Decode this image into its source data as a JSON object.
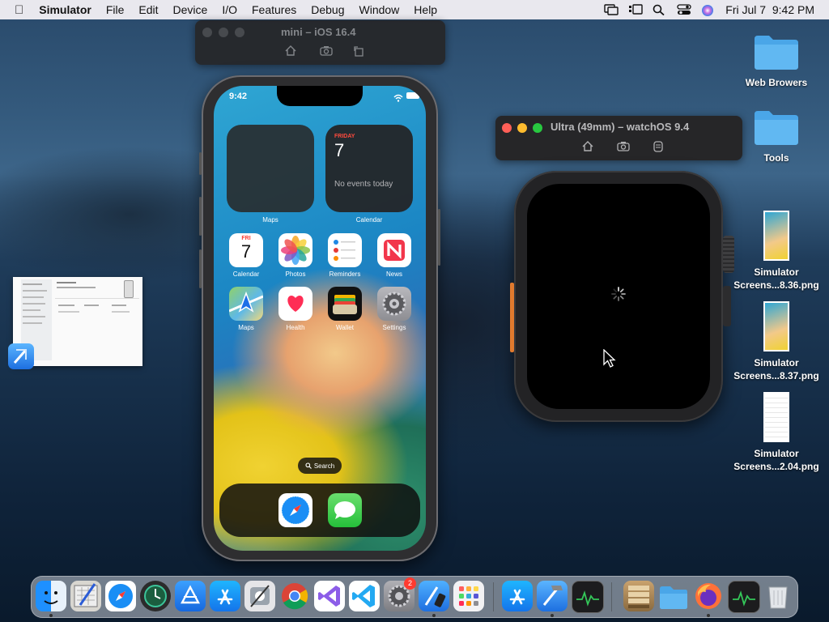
{
  "menubar": {
    "apple": "",
    "app_name": "Simulator",
    "menus": [
      "File",
      "Edit",
      "Device",
      "I/O",
      "Features",
      "Debug",
      "Window",
      "Help"
    ],
    "clock": "Fri Jul 7  9:42 PM"
  },
  "iphone_window": {
    "title": "mini – iOS 16.4",
    "tools": [
      "home-icon",
      "screenshot-icon",
      "rotate-icon"
    ]
  },
  "watch_window": {
    "title": "Ultra (49mm) – watchOS 9.4",
    "tools": [
      "home-icon",
      "screenshot-icon",
      "side-button-icon"
    ]
  },
  "iphone": {
    "status_time": "9:42",
    "widgets": {
      "maps_label": "Maps",
      "calendar_label": "Calendar",
      "calendar_day": "FRIDAY",
      "calendar_date": "7",
      "calendar_events": "No events today"
    },
    "apps": [
      {
        "label": "Calendar",
        "icon": "calendar-icon",
        "top": "FRI",
        "num": "7"
      },
      {
        "label": "Photos",
        "icon": "photos-icon"
      },
      {
        "label": "Reminders",
        "icon": "reminders-icon"
      },
      {
        "label": "News",
        "icon": "news-icon"
      },
      {
        "label": "Maps",
        "icon": "maps-icon"
      },
      {
        "label": "Health",
        "icon": "health-icon"
      },
      {
        "label": "Wallet",
        "icon": "wallet-icon"
      },
      {
        "label": "Settings",
        "icon": "settings-icon"
      }
    ],
    "search_pill": "Search",
    "dock": [
      "safari-icon",
      "messages-icon"
    ]
  },
  "desktop_files": [
    {
      "name": "Web Browers",
      "type": "folder"
    },
    {
      "name": "Tools",
      "type": "folder"
    },
    {
      "name": "Simulator Screens...8.36.png",
      "line1": "Simulator",
      "line2": "Screens...8.36.png",
      "type": "image"
    },
    {
      "name": "Simulator Screens...8.37.png",
      "line1": "Simulator",
      "line2": "Screens...8.37.png",
      "type": "image"
    },
    {
      "name": "Simulator Screens...2.04.png",
      "line1": "Simulator",
      "line2": "Screens...2.04.png",
      "type": "image"
    }
  ],
  "dock": {
    "badge": "2",
    "apps": [
      "finder-icon",
      "sketchpad-icon",
      "safari-icon",
      "time-machine-icon",
      "app-store-connect-icon",
      "app-store-icon",
      "system-tools-icon",
      "chrome-icon",
      "visual-studio-icon",
      "vscode-icon",
      "system-settings-icon",
      "simulator-icon",
      "launchpad-icon",
      "app-store-icon-2",
      "xcode-icon",
      "activity-monitor-icon",
      "archive-utility-icon",
      "folder-icon",
      "firefox-icon",
      "activity-monitor-icon-2",
      "trash-icon"
    ]
  }
}
